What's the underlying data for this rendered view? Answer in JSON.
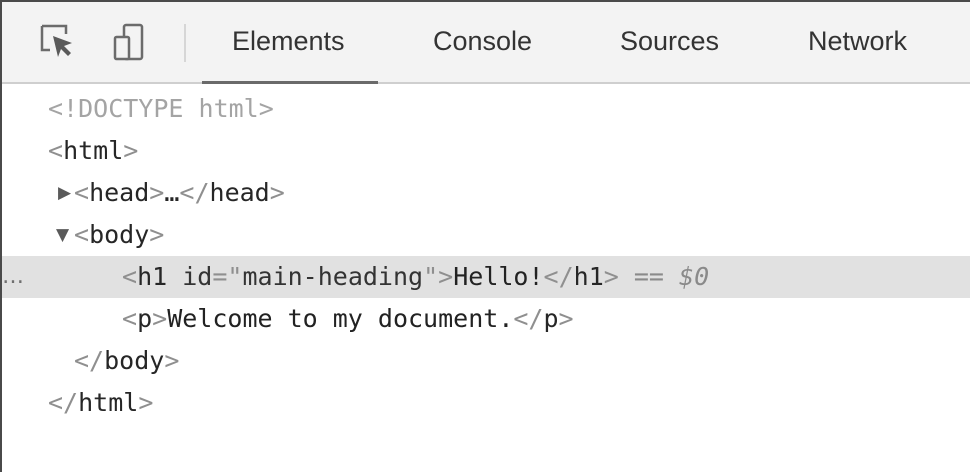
{
  "toolbar": {
    "tabs": [
      {
        "label": "Elements",
        "active": true
      },
      {
        "label": "Console",
        "active": false
      },
      {
        "label": "Sources",
        "active": false
      },
      {
        "label": "Network",
        "active": false
      }
    ],
    "icons": [
      "inspect-element-icon",
      "device-toolbar-icon"
    ]
  },
  "dom_tree": {
    "doctype": "<!DOCTYPE html>",
    "html_open": {
      "open": "<",
      "tag": "html",
      "close": ">"
    },
    "head": {
      "open": "<",
      "tag": "head",
      "close": ">",
      "ellipsis": "…",
      "end_open": "</",
      "end_tag": "head",
      "end_close": ">"
    },
    "body_open": {
      "open": "<",
      "tag": "body",
      "close": ">"
    },
    "h1": {
      "open": "<",
      "tag": "h1",
      "space": " ",
      "attr_name": "id",
      "eq": "=",
      "quote": "\"",
      "attr_value": "main-heading",
      "close": ">",
      "text": "Hello!",
      "end_open": "</",
      "end_tag": "h1",
      "end_close": ">",
      "selected_marker": "==",
      "selected_var": "$0"
    },
    "p": {
      "open": "<",
      "tag": "p",
      "close": ">",
      "text": "Welcome to my document.",
      "end_open": "</",
      "end_tag": "p",
      "end_close": ">"
    },
    "body_close": {
      "open": "</",
      "tag": "body",
      "close": ">"
    },
    "html_close": {
      "open": "</",
      "tag": "html",
      "close": ">"
    },
    "row_menu": "…"
  },
  "colors": {
    "selected_row": "#e1e1e1",
    "toolbar_bg": "#f3f3f3",
    "doctype": "#a4a4a4"
  }
}
